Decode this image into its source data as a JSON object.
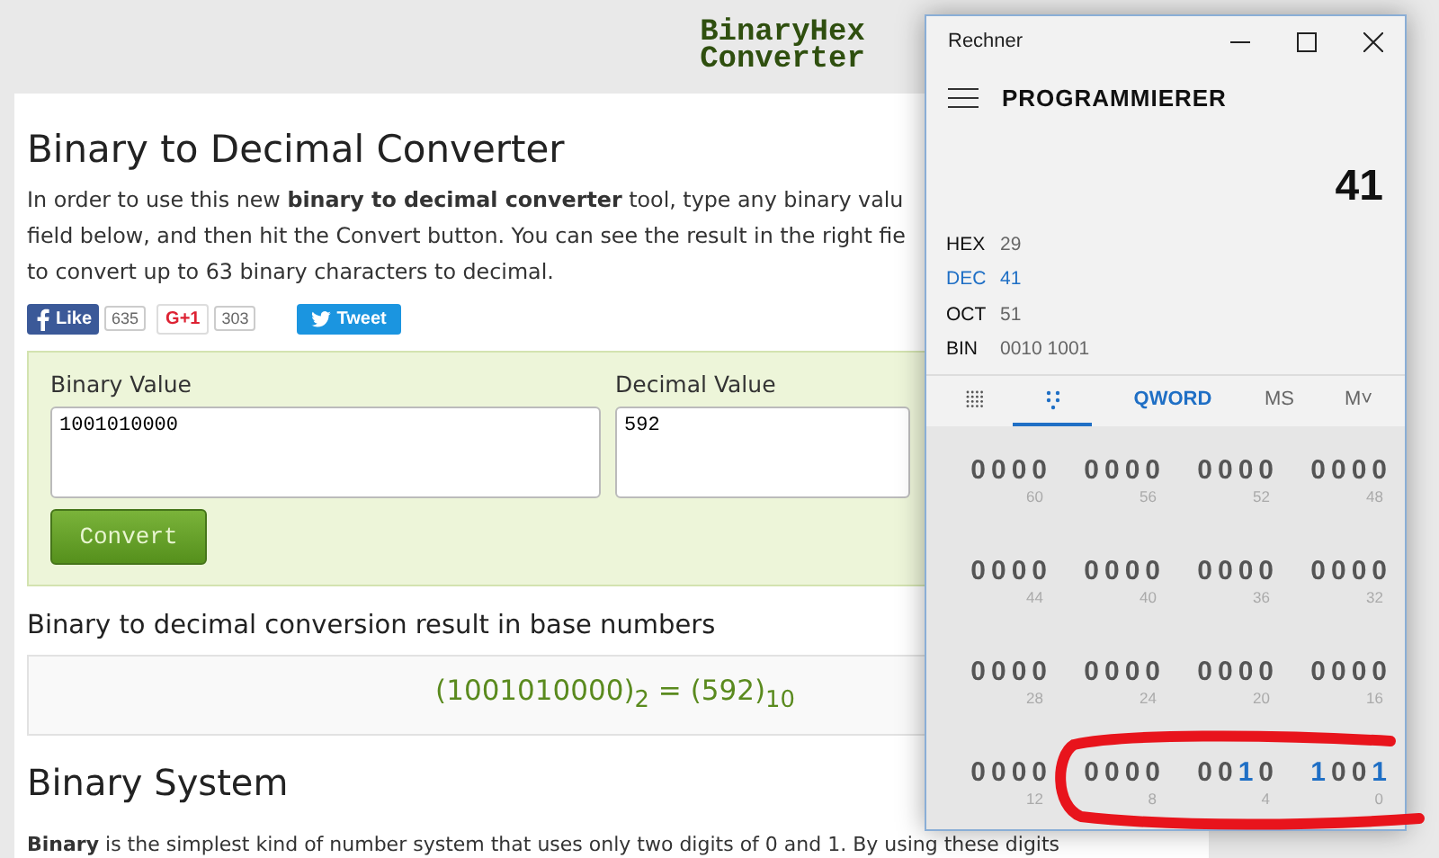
{
  "site": {
    "logo": [
      "BinaryHex",
      "Converter"
    ]
  },
  "page": {
    "title": "Binary to Decimal Converter",
    "intro": [
      "In order to use this new **binary to decimal converter** tool, type any binary valu",
      "field below, and then hit the Convert button. You can see the result in the right fie",
      "to convert up to 63 binary characters to decimal."
    ],
    "social": {
      "like_label": "Like",
      "like_count": "635",
      "gplus_label": "G+1",
      "gplus_count": "303",
      "tweet_label": "Tweet"
    },
    "converter": {
      "binary_label": "Binary Value",
      "binary_value": "1001010000",
      "decimal_label": "Decimal Value",
      "decimal_value": "592",
      "button": "Convert"
    },
    "result_heading": "Binary to decimal conversion result in base numbers",
    "result": "(1001010000)$_{2}$ = (592)$_{10}$",
    "section_title": "Binary System",
    "section_text": "**Binary** is the simplest kind of number system that uses only two digits of 0 and 1. By using these digits"
  },
  "calculator": {
    "title": "Rechner",
    "mode": "PROGRAMMIERER",
    "display": "41",
    "bases": [
      {
        "name": "HEX",
        "value": "29",
        "selected": false
      },
      {
        "name": "DEC",
        "value": "41",
        "selected": true
      },
      {
        "name": "OCT",
        "value": "51",
        "selected": false
      },
      {
        "name": "BIN",
        "value": "0010 1001",
        "selected": false
      }
    ],
    "tabs": [
      {
        "kind": "keypad",
        "selected": false
      },
      {
        "kind": "bits",
        "selected": true
      },
      {
        "kind": "word-size",
        "label": "QWORD",
        "selected": false
      },
      {
        "kind": "memory",
        "label": "MS",
        "selected": false
      },
      {
        "kind": "memory",
        "label": "M˅",
        "selected": false
      }
    ],
    "bit_groups": [
      {
        "index": "60",
        "bits": [
          {
            "digit": "0",
            "on": false
          },
          {
            "digit": "0",
            "on": false
          },
          {
            "digit": "0",
            "on": false
          },
          {
            "digit": "0",
            "on": false
          }
        ]
      },
      {
        "index": "56",
        "bits": [
          {
            "digit": "0",
            "on": false
          },
          {
            "digit": "0",
            "on": false
          },
          {
            "digit": "0",
            "on": false
          },
          {
            "digit": "0",
            "on": false
          }
        ]
      },
      {
        "index": "52",
        "bits": [
          {
            "digit": "0",
            "on": false
          },
          {
            "digit": "0",
            "on": false
          },
          {
            "digit": "0",
            "on": false
          },
          {
            "digit": "0",
            "on": false
          }
        ]
      },
      {
        "index": "48",
        "bits": [
          {
            "digit": "0",
            "on": false
          },
          {
            "digit": "0",
            "on": false
          },
          {
            "digit": "0",
            "on": false
          },
          {
            "digit": "0",
            "on": false
          }
        ]
      },
      {
        "index": "44",
        "bits": [
          {
            "digit": "0",
            "on": false
          },
          {
            "digit": "0",
            "on": false
          },
          {
            "digit": "0",
            "on": false
          },
          {
            "digit": "0",
            "on": false
          }
        ]
      },
      {
        "index": "40",
        "bits": [
          {
            "digit": "0",
            "on": false
          },
          {
            "digit": "0",
            "on": false
          },
          {
            "digit": "0",
            "on": false
          },
          {
            "digit": "0",
            "on": false
          }
        ]
      },
      {
        "index": "36",
        "bits": [
          {
            "digit": "0",
            "on": false
          },
          {
            "digit": "0",
            "on": false
          },
          {
            "digit": "0",
            "on": false
          },
          {
            "digit": "0",
            "on": false
          }
        ]
      },
      {
        "index": "32",
        "bits": [
          {
            "digit": "0",
            "on": false
          },
          {
            "digit": "0",
            "on": false
          },
          {
            "digit": "0",
            "on": false
          },
          {
            "digit": "0",
            "on": false
          }
        ]
      },
      {
        "index": "28",
        "bits": [
          {
            "digit": "0",
            "on": false
          },
          {
            "digit": "0",
            "on": false
          },
          {
            "digit": "0",
            "on": false
          },
          {
            "digit": "0",
            "on": false
          }
        ]
      },
      {
        "index": "24",
        "bits": [
          {
            "digit": "0",
            "on": false
          },
          {
            "digit": "0",
            "on": false
          },
          {
            "digit": "0",
            "on": false
          },
          {
            "digit": "0",
            "on": false
          }
        ]
      },
      {
        "index": "20",
        "bits": [
          {
            "digit": "0",
            "on": false
          },
          {
            "digit": "0",
            "on": false
          },
          {
            "digit": "0",
            "on": false
          },
          {
            "digit": "0",
            "on": false
          }
        ]
      },
      {
        "index": "16",
        "bits": [
          {
            "digit": "0",
            "on": false
          },
          {
            "digit": "0",
            "on": false
          },
          {
            "digit": "0",
            "on": false
          },
          {
            "digit": "0",
            "on": false
          }
        ]
      },
      {
        "index": "12",
        "bits": [
          {
            "digit": "0",
            "on": false
          },
          {
            "digit": "0",
            "on": false
          },
          {
            "digit": "0",
            "on": false
          },
          {
            "digit": "0",
            "on": false
          }
        ]
      },
      {
        "index": "8",
        "bits": [
          {
            "digit": "0",
            "on": false
          },
          {
            "digit": "0",
            "on": false
          },
          {
            "digit": "0",
            "on": false
          },
          {
            "digit": "0",
            "on": false
          }
        ]
      },
      {
        "index": "4",
        "bits": [
          {
            "digit": "0",
            "on": false
          },
          {
            "digit": "0",
            "on": false
          },
          {
            "digit": "1",
            "on": true
          },
          {
            "digit": "0",
            "on": false
          }
        ]
      },
      {
        "index": "0",
        "bits": [
          {
            "digit": "1",
            "on": true
          },
          {
            "digit": "0",
            "on": false
          },
          {
            "digit": "0",
            "on": false
          },
          {
            "digit": "1",
            "on": true
          }
        ]
      }
    ]
  }
}
